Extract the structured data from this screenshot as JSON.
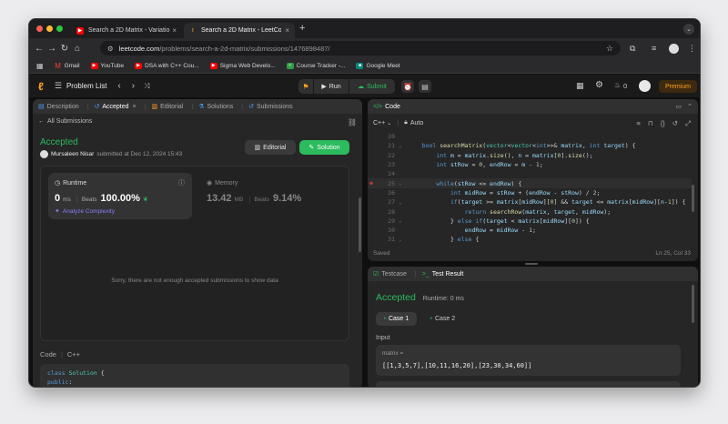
{
  "browser": {
    "tabs": [
      {
        "title": "Search a 2D Matrix - Variatio"
      },
      {
        "title": "Search a 2D Matrix - LeetCode"
      }
    ],
    "new_tab": "+",
    "url_host": "leetcode.com",
    "url_path": "/problems/search-a-2d-matrix/submissions/1476898487/",
    "bookmarks": [
      {
        "label": "Gmail",
        "color": "#ea4335"
      },
      {
        "label": "YouTube",
        "color": "#ff0000"
      },
      {
        "label": "DSA with C++ Cou...",
        "color": "#ff0000"
      },
      {
        "label": "Sigma Web Develo...",
        "color": "#ff0000"
      },
      {
        "label": "Course Tracker -...",
        "color": "#2ea043"
      },
      {
        "label": "Google Meet",
        "color": "#00897b"
      }
    ]
  },
  "lc": {
    "problem_list": "Problem List",
    "run": "Run",
    "submit": "Submit",
    "streak": "0",
    "premium": "Premium"
  },
  "left": {
    "tabs": [
      "Description",
      "Accepted",
      "Editorial",
      "Solutions",
      "Submissions"
    ],
    "all_submissions": "All Submissions",
    "status": "Accepted",
    "user": "Mursaleen Nisar",
    "submitted": "submitted at Dec 12, 2024 15:43",
    "editorial_btn": "Editorial",
    "solution_btn": "Solution",
    "runtime_label": "Runtime",
    "runtime_value": "0",
    "runtime_unit": "ms",
    "beats_label": "Beats",
    "runtime_beats": "100.00%",
    "analyze": "Analyze Complexity",
    "memory_label": "Memory",
    "memory_value": "13.42",
    "memory_unit": "MB",
    "memory_beats": "9.14%",
    "empty_msg": "Sorry, there are not enough accepted submissions to show data",
    "code_label": "Code",
    "lang": "C++",
    "code_lines": [
      [
        [
          "kw",
          "class "
        ],
        [
          "ty",
          "Solution "
        ],
        [
          "pl",
          "{"
        ]
      ],
      [
        [
          "kw",
          "public"
        ],
        [
          "pl",
          ":"
        ]
      ]
    ]
  },
  "editor": {
    "title": "Code",
    "lang": "C++",
    "mode": "Auto",
    "status_saved": "Saved",
    "cursor": "Ln 25, Col 33",
    "lines": [
      {
        "n": "20",
        "fold": "",
        "bp": false,
        "t": []
      },
      {
        "n": "21",
        "fold": "v",
        "bp": false,
        "t": [
          [
            "pl",
            "    "
          ],
          [
            "kw",
            "bool "
          ],
          [
            "fn",
            "searchMatrix"
          ],
          [
            "pl",
            "("
          ],
          [
            "ty",
            "vector"
          ],
          [
            "pl",
            "<"
          ],
          [
            "ty",
            "vector"
          ],
          [
            "pl",
            "<"
          ],
          [
            "kw",
            "int"
          ],
          [
            "pl",
            ">>& "
          ],
          [
            "id",
            "matrix"
          ],
          [
            "pl",
            ", "
          ],
          [
            "kw",
            "int "
          ],
          [
            "id",
            "target"
          ],
          [
            "pl",
            ") {"
          ]
        ]
      },
      {
        "n": "22",
        "fold": "",
        "bp": false,
        "t": [
          [
            "pl",
            "        "
          ],
          [
            "kw",
            "int "
          ],
          [
            "id",
            "m "
          ],
          [
            "pl",
            "= "
          ],
          [
            "id",
            "matrix"
          ],
          [
            "pl",
            "."
          ],
          [
            "fn",
            "size"
          ],
          [
            "pl",
            "(), "
          ],
          [
            "id",
            "n "
          ],
          [
            "pl",
            "= "
          ],
          [
            "id",
            "matrix"
          ],
          [
            "pl",
            "["
          ],
          [
            "nm",
            "0"
          ],
          [
            "pl",
            "]."
          ],
          [
            "fn",
            "size"
          ],
          [
            "pl",
            "();"
          ]
        ]
      },
      {
        "n": "23",
        "fold": "",
        "bp": false,
        "t": [
          [
            "pl",
            "        "
          ],
          [
            "kw",
            "int "
          ],
          [
            "id",
            "stRow "
          ],
          [
            "pl",
            "= "
          ],
          [
            "nm",
            "0"
          ],
          [
            "pl",
            ", "
          ],
          [
            "id",
            "endRow "
          ],
          [
            "pl",
            "= "
          ],
          [
            "id",
            "m "
          ],
          [
            "pl",
            "- "
          ],
          [
            "nm",
            "1"
          ],
          [
            "pl",
            ";"
          ]
        ]
      },
      {
        "n": "24",
        "fold": "",
        "bp": false,
        "t": []
      },
      {
        "n": "25",
        "fold": "v",
        "bp": true,
        "t": [
          [
            "pl",
            "        "
          ],
          [
            "kw",
            "while"
          ],
          [
            "pl",
            "("
          ],
          [
            "id",
            "stRow "
          ],
          [
            "pl",
            "<= "
          ],
          [
            "id",
            "endRow"
          ],
          [
            "pl",
            ") {"
          ]
        ]
      },
      {
        "n": "26",
        "fold": "",
        "bp": false,
        "t": [
          [
            "pl",
            "            "
          ],
          [
            "kw",
            "int "
          ],
          [
            "id",
            "midRow "
          ],
          [
            "pl",
            "= "
          ],
          [
            "id",
            "stRow "
          ],
          [
            "pl",
            "+ ("
          ],
          [
            "id",
            "endRow "
          ],
          [
            "pl",
            "- "
          ],
          [
            "id",
            "stRow"
          ],
          [
            "pl",
            ") / "
          ],
          [
            "nm",
            "2"
          ],
          [
            "pl",
            ";"
          ]
        ]
      },
      {
        "n": "27",
        "fold": "v",
        "bp": false,
        "t": [
          [
            "pl",
            "            "
          ],
          [
            "kw",
            "if"
          ],
          [
            "pl",
            "("
          ],
          [
            "id",
            "target "
          ],
          [
            "pl",
            ">= "
          ],
          [
            "id",
            "matrix"
          ],
          [
            "pl",
            "["
          ],
          [
            "id",
            "midRow"
          ],
          [
            "pl",
            "]["
          ],
          [
            "nm",
            "0"
          ],
          [
            "pl",
            "] && "
          ],
          [
            "id",
            "target "
          ],
          [
            "pl",
            "<= "
          ],
          [
            "id",
            "matrix"
          ],
          [
            "pl",
            "["
          ],
          [
            "id",
            "midRow"
          ],
          [
            "pl",
            "]["
          ],
          [
            "id",
            "n"
          ],
          [
            "pl",
            "-"
          ],
          [
            "nm",
            "1"
          ],
          [
            "pl",
            "]) {"
          ]
        ]
      },
      {
        "n": "28",
        "fold": "",
        "bp": false,
        "t": [
          [
            "pl",
            "                "
          ],
          [
            "kw",
            "return "
          ],
          [
            "fn",
            "searchRow"
          ],
          [
            "pl",
            "("
          ],
          [
            "id",
            "matrix"
          ],
          [
            "pl",
            ", "
          ],
          [
            "id",
            "target"
          ],
          [
            "pl",
            ", "
          ],
          [
            "id",
            "midRow"
          ],
          [
            "pl",
            ");"
          ]
        ]
      },
      {
        "n": "29",
        "fold": "v",
        "bp": false,
        "t": [
          [
            "pl",
            "            } "
          ],
          [
            "kw",
            "else if"
          ],
          [
            "pl",
            "("
          ],
          [
            "id",
            "target "
          ],
          [
            "pl",
            "< "
          ],
          [
            "id",
            "matrix"
          ],
          [
            "pl",
            "["
          ],
          [
            "id",
            "midRow"
          ],
          [
            "pl",
            "]["
          ],
          [
            "nm",
            "0"
          ],
          [
            "pl",
            "]) {"
          ]
        ]
      },
      {
        "n": "30",
        "fold": "",
        "bp": false,
        "t": [
          [
            "pl",
            "                "
          ],
          [
            "id",
            "endRow "
          ],
          [
            "pl",
            "= "
          ],
          [
            "id",
            "midRow "
          ],
          [
            "pl",
            "- "
          ],
          [
            "nm",
            "1"
          ],
          [
            "pl",
            ";"
          ]
        ]
      },
      {
        "n": "31",
        "fold": "v",
        "bp": false,
        "t": [
          [
            "pl",
            "            } "
          ],
          [
            "kw",
            "else "
          ],
          [
            "pl",
            "{"
          ]
        ]
      }
    ]
  },
  "bottom": {
    "tab_testcase": "Testcase",
    "tab_result": "Test Result",
    "status": "Accepted",
    "runtime": "Runtime: 0 ms",
    "case1": "Case 1",
    "case2": "Case 2",
    "input_label": "Input",
    "var_name": "matrix =",
    "var_value": "[[1,3,5,7],[10,11,16,20],[23,30,34,60]]"
  },
  "colors": {
    "accent_green": "#2cbb5d",
    "orange": "#ffa116",
    "run_bg": "#3a3a3a",
    "submit_green": "#2cbb5d"
  }
}
